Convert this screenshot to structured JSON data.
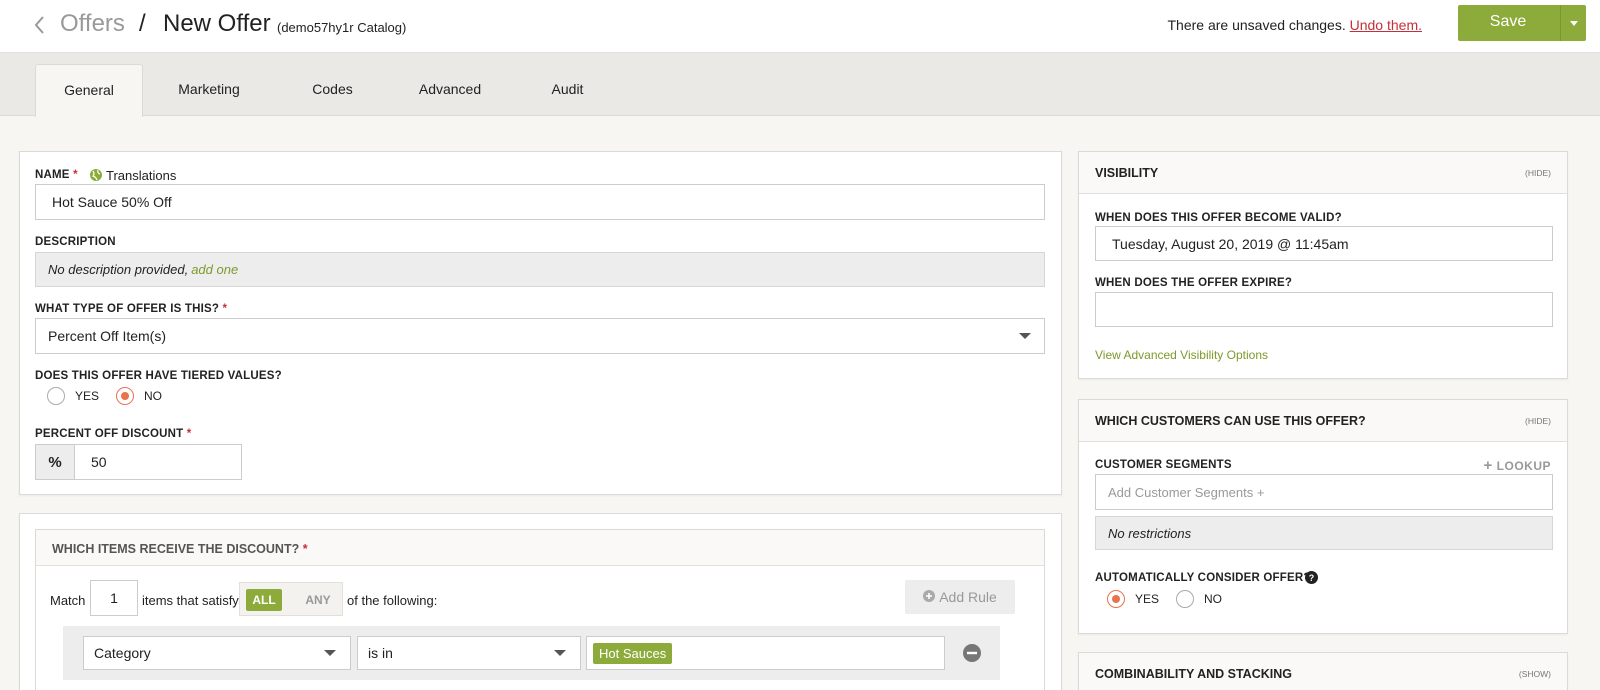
{
  "header": {
    "breadcrumb_root": "Offers",
    "separator": "/",
    "title": "New Offer",
    "catalog": "(demo57hy1r Catalog)",
    "unsaved_text": "There are unsaved changes.",
    "undo_link": "Undo them.",
    "save_label": "Save"
  },
  "tabs": [
    {
      "label": "General",
      "active": true
    },
    {
      "label": "Marketing"
    },
    {
      "label": "Codes"
    },
    {
      "label": "Advanced"
    },
    {
      "label": "Audit"
    }
  ],
  "general": {
    "name_label": "NAME",
    "translations_label": "Translations",
    "name_value": "Hot Sauce 50% Off",
    "description_label": "DESCRIPTION",
    "description_empty": "No description provided,",
    "description_add": "add one",
    "type_label": "WHAT TYPE OF OFFER IS THIS?",
    "type_value": "Percent Off Item(s)",
    "tiered_label": "DOES THIS OFFER HAVE TIERED VALUES?",
    "tiered_yes": "YES",
    "tiered_no": "NO",
    "tiered_selected": "NO",
    "percent_label": "PERCENT OFF DISCOUNT",
    "percent_symbol": "%",
    "percent_value": "50",
    "required_mark": "*"
  },
  "items": {
    "title": "WHICH ITEMS RECEIVE THE DISCOUNT?",
    "match_label": "Match",
    "match_value": "1",
    "satisfy_label": "items that satisfy",
    "all_label": "ALL",
    "any_label": "ANY",
    "following_label": "of the following:",
    "add_rule_label": "Add Rule",
    "rule": {
      "field": "Category",
      "operator": "is in",
      "tag": "Hot Sauces"
    }
  },
  "visibility": {
    "title": "VISIBILITY",
    "toggle": "(HIDE)",
    "valid_label": "WHEN DOES THIS OFFER BECOME VALID?",
    "valid_value": "Tuesday, August 20, 2019 @ 11:45am",
    "expire_label": "WHEN DOES THE OFFER EXPIRE?",
    "expire_value": "",
    "advanced_link": "View Advanced Visibility Options"
  },
  "customers": {
    "title": "WHICH CUSTOMERS CAN USE THIS OFFER?",
    "toggle": "(HIDE)",
    "segments_label": "CUSTOMER SEGMENTS",
    "lookup_label": "LOOKUP",
    "segments_placeholder": "Add Customer Segments +",
    "no_restrictions": "No restrictions",
    "auto_label": "AUTOMATICALLY CONSIDER OFFER?",
    "auto_yes": "YES",
    "auto_no": "NO",
    "auto_selected": "YES"
  },
  "combinability": {
    "title": "COMBINABILITY AND STACKING",
    "toggle": "(SHOW)"
  },
  "colors": {
    "accent_green": "#8dab3a",
    "link_green": "#7c9a2b",
    "required_red": "#c62e3b",
    "radio_orange": "#e8734e"
  }
}
